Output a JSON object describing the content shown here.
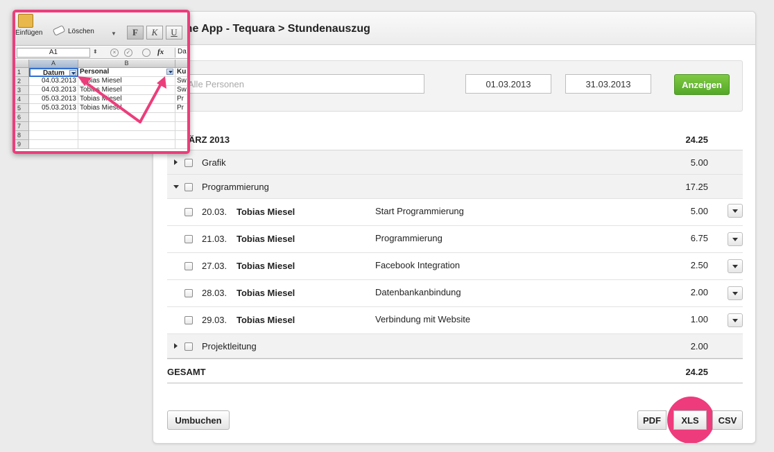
{
  "colors": {
    "accent_pink": "#ec3d7b",
    "show_button_green": "#5bb02c",
    "panel_bg": "#ffffff"
  },
  "header": {
    "title": "Meine App - Tequara > Stundenauszug"
  },
  "filters": {
    "person_placeholder": "Alle Personen",
    "date_from": "01.03.2013",
    "date_to": "31.03.2013",
    "show_button": "Anzeigen"
  },
  "report": {
    "month_label": "MÄRZ 2013",
    "month_total": "24.25",
    "categories": [
      {
        "label": "Grafik",
        "total": "5.00",
        "expanded": false
      },
      {
        "label": "Programmierung",
        "total": "17.25",
        "expanded": true
      },
      {
        "label": "Projektleitung",
        "total": "2.00",
        "expanded": false
      }
    ],
    "entries": [
      {
        "date": "20.03.",
        "person": "Tobias Miesel",
        "description": "Start Programmierung",
        "hours": "5.00"
      },
      {
        "date": "21.03.",
        "person": "Tobias Miesel",
        "description": "Programmierung",
        "hours": "6.75"
      },
      {
        "date": "27.03.",
        "person": "Tobias Miesel",
        "description": "Facebook Integration",
        "hours": "2.50"
      },
      {
        "date": "28.03.",
        "person": "Tobias Miesel",
        "description": "Datenbankanbindung",
        "hours": "2.00"
      },
      {
        "date": "29.03.",
        "person": "Tobias Miesel",
        "description": "Verbindung mit Website",
        "hours": "1.00"
      }
    ],
    "total_label": "GESAMT",
    "total_value": "24.25"
  },
  "actions": {
    "rebook": "Umbuchen",
    "pdf": "PDF",
    "xls": "XLS",
    "csv": "CSV"
  },
  "spreadsheet": {
    "ribbon": {
      "paste": "Einfügen",
      "clear": "Löschen",
      "bold": "F",
      "italic": "K",
      "underline": "U"
    },
    "name_box": "A1",
    "fx": "fx",
    "formula_value": "Da",
    "column_letters": [
      "A",
      "B"
    ],
    "row_numbers": [
      "1",
      "2",
      "3",
      "4",
      "5",
      "6",
      "7",
      "8",
      "9"
    ],
    "headers": {
      "a": "Datum",
      "b": "Personal",
      "c": "Ku"
    },
    "rows": [
      {
        "a": "04.03.2013",
        "b": "Tobias Miesel",
        "c": "Sw"
      },
      {
        "a": "04.03.2013",
        "b": "Tobias Miesel",
        "c": "Sw"
      },
      {
        "a": "05.03.2013",
        "b": "Tobias Miesel",
        "c": "Pr"
      },
      {
        "a": "05.03.2013",
        "b": "Tobias Miesel",
        "c": "Pr"
      }
    ]
  }
}
